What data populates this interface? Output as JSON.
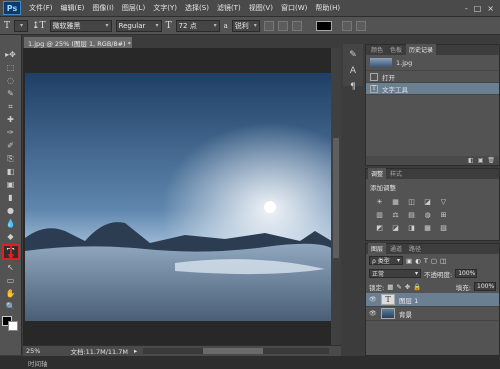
{
  "app": {
    "logo": "Ps",
    "window_controls": [
      "-",
      "□",
      "×"
    ]
  },
  "menu": [
    "文件(F)",
    "编辑(E)",
    "图像(I)",
    "图层(L)",
    "文字(Y)",
    "选择(S)",
    "滤镜(T)",
    "视图(V)",
    "窗口(W)",
    "帮助(H)"
  ],
  "options": {
    "tool_glyph": "T",
    "orient_glyph": "↨T",
    "font_family": "微软雅黑",
    "font_style": "Regular",
    "size_glyph": "T",
    "font_size": "72 点",
    "aa_label": "a",
    "aa_mode": "锐利"
  },
  "document": {
    "tab_title": "1.jpg @ 25% (图层 1, RGB/8#) *",
    "close_glyph": "×",
    "zoom": "25%",
    "doc_info": "文档:11.7M/11.7M",
    "timeline_tab": "时间轴"
  },
  "tools": [
    "▸✥",
    "⬚",
    "◌",
    "✎",
    "⌗",
    "✚",
    "✑",
    "✐",
    "⎘",
    "◧",
    "▣",
    "▮",
    "●",
    "💧",
    "◆"
  ],
  "active_tool": "T",
  "tools_below": [
    "↖",
    "▭",
    "✋",
    "🔍"
  ],
  "history": {
    "tabs": [
      "颜色",
      "色板",
      "历史记录"
    ],
    "active_tab": 2,
    "snapshot_label": "1.jpg",
    "rows": [
      {
        "label": "打开",
        "selected": false
      },
      {
        "label": "文字工具",
        "selected": true
      }
    ]
  },
  "adjustments": {
    "tabs": [
      "调整",
      "样式"
    ],
    "active_tab": 0,
    "title": "添加调整",
    "icons": [
      "☀",
      "▦",
      "◫",
      "◪",
      "▽",
      "",
      "▥",
      "⚖",
      "▤",
      "◍",
      "⊞",
      "",
      "◩",
      "◪",
      "◨",
      "▦",
      "▧",
      ""
    ]
  },
  "layers": {
    "tabs": [
      "图层",
      "通道",
      "路径"
    ],
    "active_tab": 0,
    "filter_label": "ρ 类型",
    "blend_mode": "正常",
    "opacity_label": "不透明度:",
    "opacity_value": "100%",
    "lock_label": "锁定:",
    "fill_label": "填充:",
    "fill_value": "100%",
    "items": [
      {
        "name": "图层 1",
        "thumb": "T",
        "selected": true
      },
      {
        "name": "背景",
        "thumb": "",
        "selected": false
      }
    ]
  },
  "colors": {
    "accent_red": "#e02020",
    "selection": "#6b7f93"
  }
}
